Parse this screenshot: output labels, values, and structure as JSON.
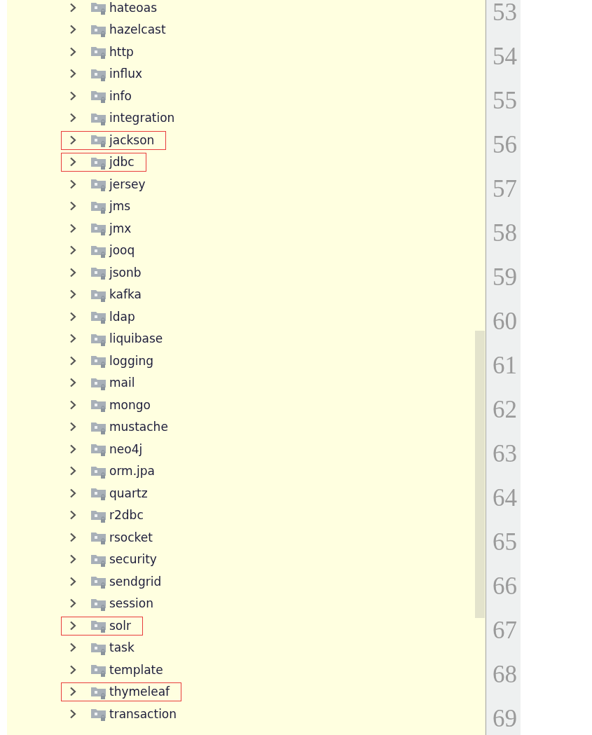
{
  "tree": {
    "items": [
      {
        "label": "hateoas",
        "expanded": false,
        "highlighted": false
      },
      {
        "label": "hazelcast",
        "expanded": false,
        "highlighted": false
      },
      {
        "label": "http",
        "expanded": false,
        "highlighted": false
      },
      {
        "label": "influx",
        "expanded": false,
        "highlighted": false
      },
      {
        "label": "info",
        "expanded": false,
        "highlighted": false
      },
      {
        "label": "integration",
        "expanded": false,
        "highlighted": false
      },
      {
        "label": "jackson",
        "expanded": false,
        "highlighted": true
      },
      {
        "label": "jdbc",
        "expanded": false,
        "highlighted": true
      },
      {
        "label": "jersey",
        "expanded": false,
        "highlighted": false
      },
      {
        "label": "jms",
        "expanded": false,
        "highlighted": false
      },
      {
        "label": "jmx",
        "expanded": false,
        "highlighted": false
      },
      {
        "label": "jooq",
        "expanded": false,
        "highlighted": false
      },
      {
        "label": "jsonb",
        "expanded": false,
        "highlighted": false
      },
      {
        "label": "kafka",
        "expanded": false,
        "highlighted": false
      },
      {
        "label": "ldap",
        "expanded": false,
        "highlighted": false
      },
      {
        "label": "liquibase",
        "expanded": false,
        "highlighted": false
      },
      {
        "label": "logging",
        "expanded": false,
        "highlighted": false
      },
      {
        "label": "mail",
        "expanded": false,
        "highlighted": false
      },
      {
        "label": "mongo",
        "expanded": false,
        "highlighted": false
      },
      {
        "label": "mustache",
        "expanded": false,
        "highlighted": false
      },
      {
        "label": "neo4j",
        "expanded": false,
        "highlighted": false
      },
      {
        "label": "orm.jpa",
        "expanded": false,
        "highlighted": false
      },
      {
        "label": "quartz",
        "expanded": false,
        "highlighted": false
      },
      {
        "label": "r2dbc",
        "expanded": false,
        "highlighted": false
      },
      {
        "label": "rsocket",
        "expanded": false,
        "highlighted": false
      },
      {
        "label": "security",
        "expanded": false,
        "highlighted": false
      },
      {
        "label": "sendgrid",
        "expanded": false,
        "highlighted": false
      },
      {
        "label": "session",
        "expanded": false,
        "highlighted": false
      },
      {
        "label": "solr",
        "expanded": false,
        "highlighted": true
      },
      {
        "label": "task",
        "expanded": false,
        "highlighted": false
      },
      {
        "label": "template",
        "expanded": false,
        "highlighted": false
      },
      {
        "label": "thymeleaf",
        "expanded": false,
        "highlighted": true
      },
      {
        "label": "transaction",
        "expanded": false,
        "highlighted": false
      }
    ]
  },
  "gutter": {
    "line_numbers": [
      "53",
      "54",
      "55",
      "56",
      "57",
      "58",
      "59",
      "60",
      "61",
      "62",
      "63",
      "64",
      "65",
      "66",
      "67",
      "68",
      "69"
    ]
  }
}
